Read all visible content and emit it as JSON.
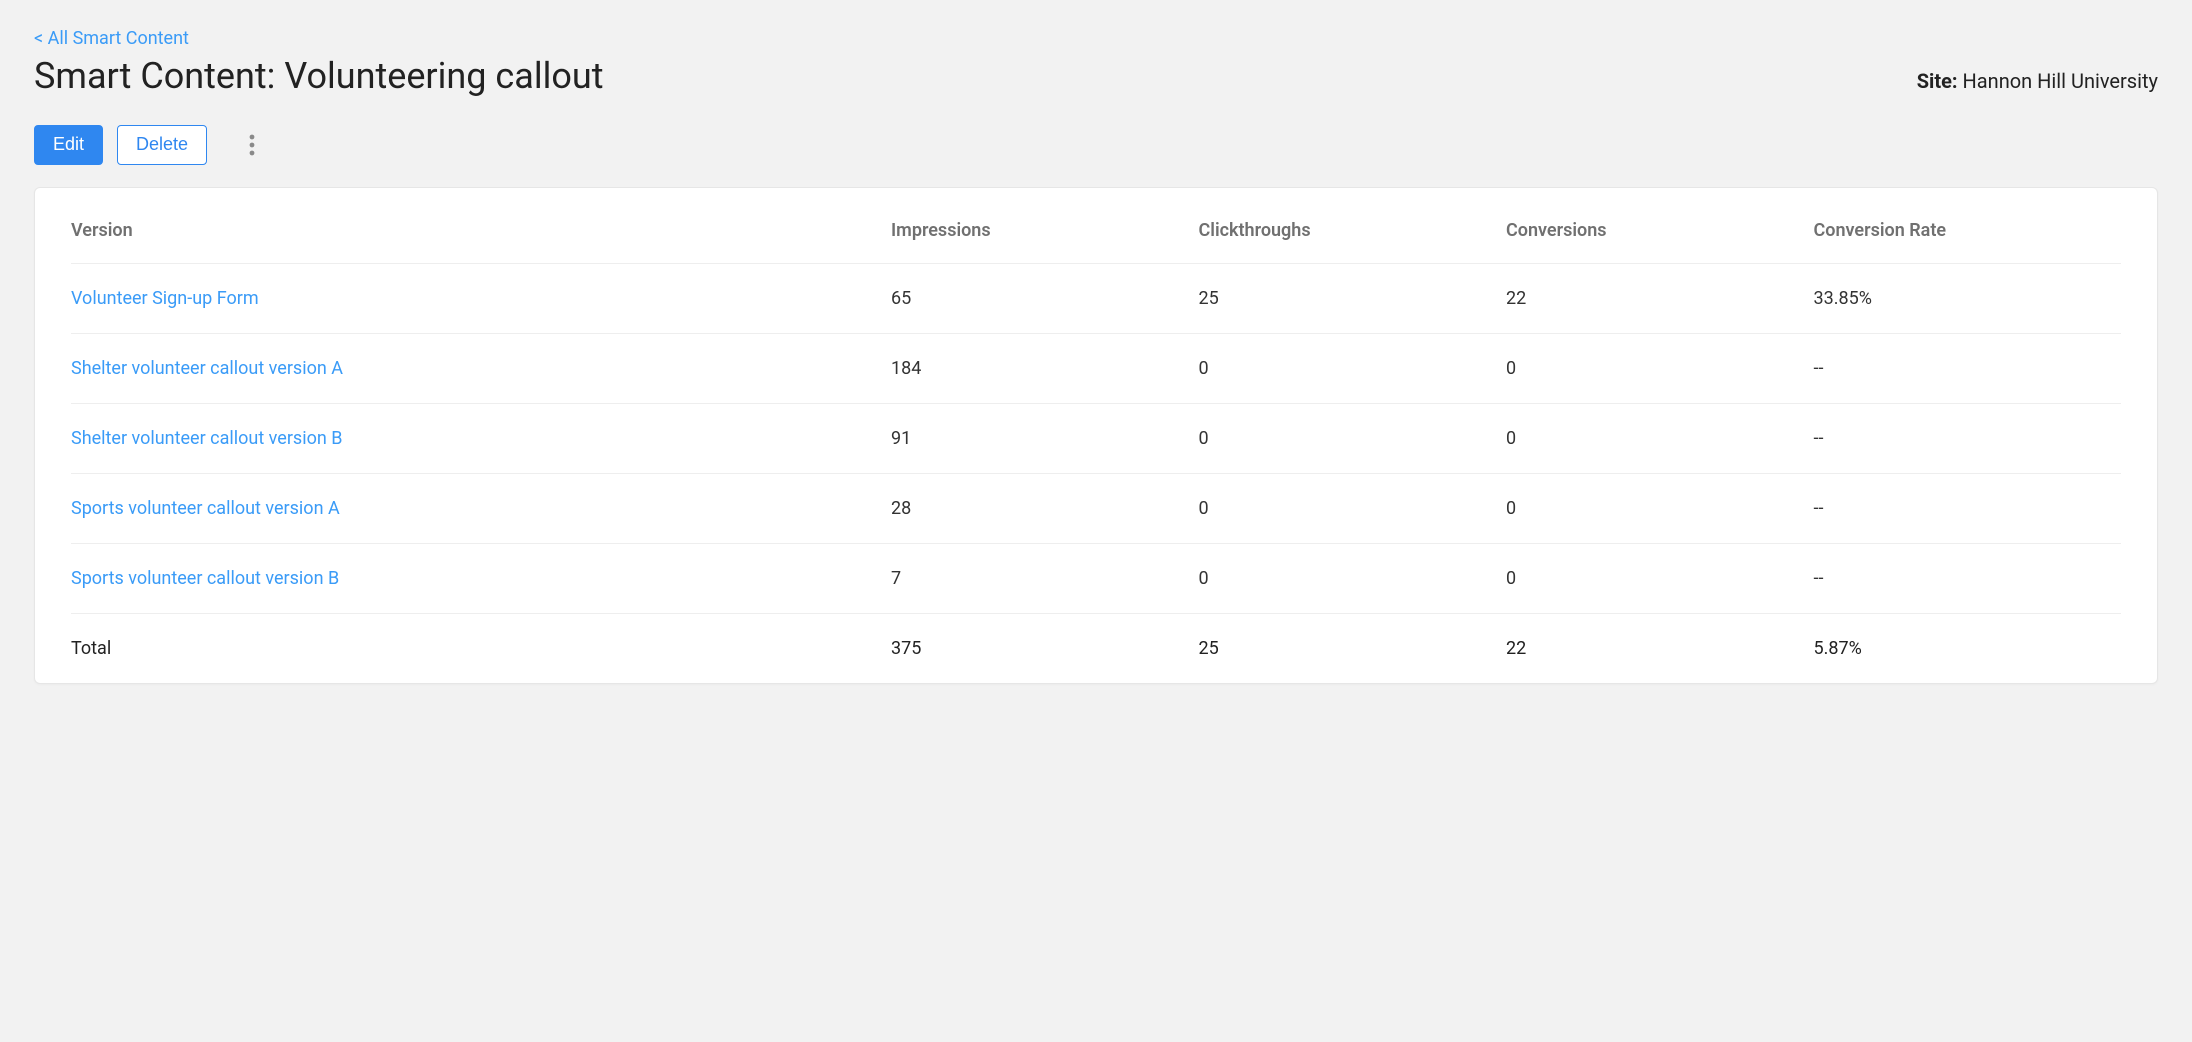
{
  "breadcrumb": {
    "label": "< All Smart Content"
  },
  "header": {
    "title": "Smart Content: Volunteering callout",
    "site_label": "Site:",
    "site_name": "Hannon Hill University"
  },
  "toolbar": {
    "edit_label": "Edit",
    "delete_label": "Delete"
  },
  "table": {
    "columns": {
      "version": "Version",
      "impressions": "Impressions",
      "clickthroughs": "Clickthroughs",
      "conversions": "Conversions",
      "conversion_rate": "Conversion Rate"
    },
    "rows": [
      {
        "version": "Volunteer Sign-up Form",
        "impressions": "65",
        "clickthroughs": "25",
        "conversions": "22",
        "conversion_rate": "33.85%"
      },
      {
        "version": "Shelter volunteer callout version A",
        "impressions": "184",
        "clickthroughs": "0",
        "conversions": "0",
        "conversion_rate": "--"
      },
      {
        "version": "Shelter volunteer callout version B",
        "impressions": "91",
        "clickthroughs": "0",
        "conversions": "0",
        "conversion_rate": "--"
      },
      {
        "version": "Sports volunteer callout version A",
        "impressions": "28",
        "clickthroughs": "0",
        "conversions": "0",
        "conversion_rate": "--"
      },
      {
        "version": "Sports volunteer callout version B",
        "impressions": "7",
        "clickthroughs": "0",
        "conversions": "0",
        "conversion_rate": "--"
      }
    ],
    "total": {
      "label": "Total",
      "impressions": "375",
      "clickthroughs": "25",
      "conversions": "22",
      "conversion_rate": "5.87%"
    }
  }
}
